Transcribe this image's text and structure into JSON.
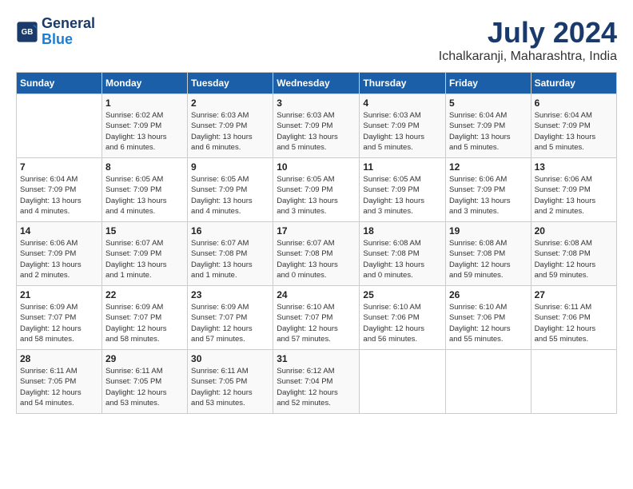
{
  "header": {
    "logo_line1": "General",
    "logo_line2": "Blue",
    "month": "July 2024",
    "location": "Ichalkaranji, Maharashtra, India"
  },
  "weekdays": [
    "Sunday",
    "Monday",
    "Tuesday",
    "Wednesday",
    "Thursday",
    "Friday",
    "Saturday"
  ],
  "weeks": [
    [
      {
        "day": "",
        "info": ""
      },
      {
        "day": "1",
        "info": "Sunrise: 6:02 AM\nSunset: 7:09 PM\nDaylight: 13 hours\nand 6 minutes."
      },
      {
        "day": "2",
        "info": "Sunrise: 6:03 AM\nSunset: 7:09 PM\nDaylight: 13 hours\nand 6 minutes."
      },
      {
        "day": "3",
        "info": "Sunrise: 6:03 AM\nSunset: 7:09 PM\nDaylight: 13 hours\nand 5 minutes."
      },
      {
        "day": "4",
        "info": "Sunrise: 6:03 AM\nSunset: 7:09 PM\nDaylight: 13 hours\nand 5 minutes."
      },
      {
        "day": "5",
        "info": "Sunrise: 6:04 AM\nSunset: 7:09 PM\nDaylight: 13 hours\nand 5 minutes."
      },
      {
        "day": "6",
        "info": "Sunrise: 6:04 AM\nSunset: 7:09 PM\nDaylight: 13 hours\nand 5 minutes."
      }
    ],
    [
      {
        "day": "7",
        "info": "Sunrise: 6:04 AM\nSunset: 7:09 PM\nDaylight: 13 hours\nand 4 minutes."
      },
      {
        "day": "8",
        "info": "Sunrise: 6:05 AM\nSunset: 7:09 PM\nDaylight: 13 hours\nand 4 minutes."
      },
      {
        "day": "9",
        "info": "Sunrise: 6:05 AM\nSunset: 7:09 PM\nDaylight: 13 hours\nand 4 minutes."
      },
      {
        "day": "10",
        "info": "Sunrise: 6:05 AM\nSunset: 7:09 PM\nDaylight: 13 hours\nand 3 minutes."
      },
      {
        "day": "11",
        "info": "Sunrise: 6:05 AM\nSunset: 7:09 PM\nDaylight: 13 hours\nand 3 minutes."
      },
      {
        "day": "12",
        "info": "Sunrise: 6:06 AM\nSunset: 7:09 PM\nDaylight: 13 hours\nand 3 minutes."
      },
      {
        "day": "13",
        "info": "Sunrise: 6:06 AM\nSunset: 7:09 PM\nDaylight: 13 hours\nand 2 minutes."
      }
    ],
    [
      {
        "day": "14",
        "info": "Sunrise: 6:06 AM\nSunset: 7:09 PM\nDaylight: 13 hours\nand 2 minutes."
      },
      {
        "day": "15",
        "info": "Sunrise: 6:07 AM\nSunset: 7:09 PM\nDaylight: 13 hours\nand 1 minute."
      },
      {
        "day": "16",
        "info": "Sunrise: 6:07 AM\nSunset: 7:08 PM\nDaylight: 13 hours\nand 1 minute."
      },
      {
        "day": "17",
        "info": "Sunrise: 6:07 AM\nSunset: 7:08 PM\nDaylight: 13 hours\nand 0 minutes."
      },
      {
        "day": "18",
        "info": "Sunrise: 6:08 AM\nSunset: 7:08 PM\nDaylight: 13 hours\nand 0 minutes."
      },
      {
        "day": "19",
        "info": "Sunrise: 6:08 AM\nSunset: 7:08 PM\nDaylight: 12 hours\nand 59 minutes."
      },
      {
        "day": "20",
        "info": "Sunrise: 6:08 AM\nSunset: 7:08 PM\nDaylight: 12 hours\nand 59 minutes."
      }
    ],
    [
      {
        "day": "21",
        "info": "Sunrise: 6:09 AM\nSunset: 7:07 PM\nDaylight: 12 hours\nand 58 minutes."
      },
      {
        "day": "22",
        "info": "Sunrise: 6:09 AM\nSunset: 7:07 PM\nDaylight: 12 hours\nand 58 minutes."
      },
      {
        "day": "23",
        "info": "Sunrise: 6:09 AM\nSunset: 7:07 PM\nDaylight: 12 hours\nand 57 minutes."
      },
      {
        "day": "24",
        "info": "Sunrise: 6:10 AM\nSunset: 7:07 PM\nDaylight: 12 hours\nand 57 minutes."
      },
      {
        "day": "25",
        "info": "Sunrise: 6:10 AM\nSunset: 7:06 PM\nDaylight: 12 hours\nand 56 minutes."
      },
      {
        "day": "26",
        "info": "Sunrise: 6:10 AM\nSunset: 7:06 PM\nDaylight: 12 hours\nand 55 minutes."
      },
      {
        "day": "27",
        "info": "Sunrise: 6:11 AM\nSunset: 7:06 PM\nDaylight: 12 hours\nand 55 minutes."
      }
    ],
    [
      {
        "day": "28",
        "info": "Sunrise: 6:11 AM\nSunset: 7:05 PM\nDaylight: 12 hours\nand 54 minutes."
      },
      {
        "day": "29",
        "info": "Sunrise: 6:11 AM\nSunset: 7:05 PM\nDaylight: 12 hours\nand 53 minutes."
      },
      {
        "day": "30",
        "info": "Sunrise: 6:11 AM\nSunset: 7:05 PM\nDaylight: 12 hours\nand 53 minutes."
      },
      {
        "day": "31",
        "info": "Sunrise: 6:12 AM\nSunset: 7:04 PM\nDaylight: 12 hours\nand 52 minutes."
      },
      {
        "day": "",
        "info": ""
      },
      {
        "day": "",
        "info": ""
      },
      {
        "day": "",
        "info": ""
      }
    ]
  ]
}
